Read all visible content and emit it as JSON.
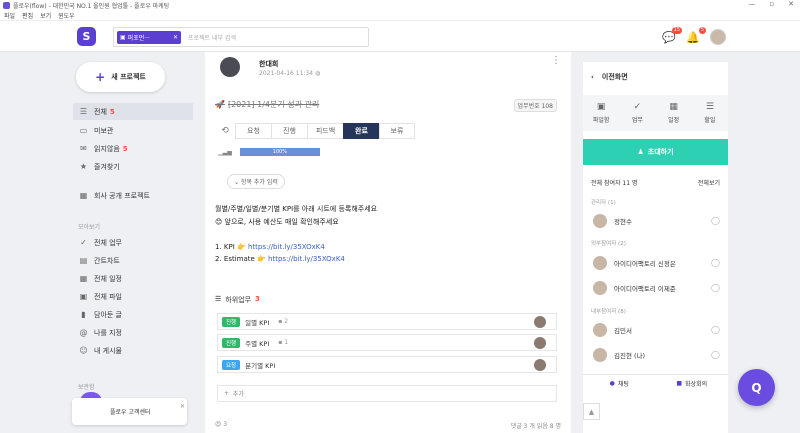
{
  "window": {
    "title": "플로우(flow) - 대한민국 NO.1 올인원 협업툴 - 플로우 마케팅",
    "controls": [
      "—",
      "▫",
      "✕"
    ]
  },
  "menu": [
    "파일",
    "편집",
    "보기",
    "윈도우"
  ],
  "topbar": {
    "chip": "퍼포먼···",
    "search_placeholder": "프로젝트 내부 검색",
    "chat_badge": "15",
    "bell_badge": "5"
  },
  "sidebar": {
    "new_project": "새 프로젝트",
    "items": [
      {
        "label": "전체",
        "count": "5"
      },
      {
        "label": "미보관",
        "count": ""
      },
      {
        "label": "읽지않음",
        "count": "5"
      },
      {
        "label": "즐겨찾기",
        "count": ""
      },
      {
        "label": "회사 공개 프로젝트",
        "count": ""
      }
    ],
    "section_title": "모아보기",
    "collect": [
      "전체 업무",
      "간트차트",
      "전체 일정",
      "전체 파일",
      "담아둔 글",
      "나를 지정",
      "내 게시물"
    ],
    "label_section": "보관함",
    "help": "플로우 고객센터"
  },
  "post": {
    "author": "한대희",
    "date": "2021-04-16 11:34",
    "title": "[2021] 1/4분기 성과 관리",
    "task_no": "업무번호 108",
    "statuses": [
      "요청",
      "진행",
      "피드백",
      "완료",
      "보류"
    ],
    "selected_status": "완료",
    "progress": "100%",
    "add_field": "항목 추가 입력",
    "lines": [
      "월별/주별/일별/분기별 KPI를 아래 시트에 등록해주세요",
      "앞으로, 사용 예산도 매일 확인해주세요",
      "",
      "1. KPI",
      "2. Estimate"
    ],
    "links": [
      "https://bit.ly/35XOxK4",
      "https://bit.ly/35XOxK4"
    ],
    "subtask_title": "하위업무",
    "subtask_count": "3",
    "subtasks": [
      {
        "status": "진행",
        "name": "일별 KPI",
        "comments": "2"
      },
      {
        "status": "진행",
        "name": "주별 KPI",
        "comments": "1"
      },
      {
        "status": "요청",
        "name": "분기별 KPI",
        "comments": ""
      }
    ],
    "add_subtask": "추가",
    "reaction_count": "3",
    "footer_stats": "댓글 3 개  읽음 8 명"
  },
  "right": {
    "back": "이전화면",
    "tabs": [
      "파일함",
      "업무",
      "일정",
      "할일"
    ],
    "invite": "초대하기",
    "members_title": "전체 참여자 11 명",
    "view_all": "전체보기",
    "groups": [
      {
        "title": "관리자 (1)",
        "members": [
          "정현수"
        ]
      },
      {
        "title": "외부참여자 (2)",
        "members": [
          "아이디어팩토리 신정은",
          "아이디어팩토리 이제준"
        ]
      },
      {
        "title": "내부참여자 (8)",
        "members": [
          "김민서",
          "김진현 (나)"
        ]
      }
    ],
    "footer": [
      "채팅",
      "화상회의"
    ]
  },
  "colors": {
    "brand": "#5b3fd1",
    "invite": "#2ed0b3",
    "done": "#26355a",
    "progress": "#2fb96a",
    "request": "#3ea6ef",
    "badge": "#ff4a3d"
  }
}
